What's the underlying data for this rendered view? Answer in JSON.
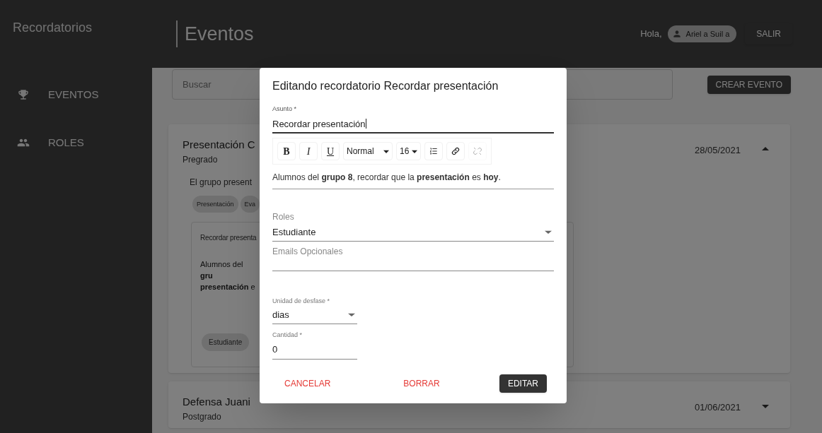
{
  "app_title": "Recordatorios",
  "page_title": "Eventos",
  "greeting": "Hola,",
  "user_chip": "Ariel a Suil a",
  "logout_button": "SALIR",
  "sidebar": {
    "items": [
      {
        "label": "EVENTOS",
        "kind": "trophy"
      },
      {
        "label": "ROLES",
        "kind": "group"
      }
    ]
  },
  "search": {
    "placeholder": "Buscar"
  },
  "create_button": "CREAR EVENTO",
  "events": [
    {
      "title": "Presentación C",
      "subtitle": "Pregrado",
      "date": "28/05/2021",
      "expanded": true,
      "description": "El grupo present",
      "tags": [
        "Presentación",
        "Eva"
      ],
      "reminder": {
        "subject": "Recordar presenta",
        "body": "Alumnos del **gru** **presentación** e",
        "roles": [
          "Estudiante"
        ]
      }
    },
    {
      "title": "Defensa Juani",
      "subtitle": "Postgrado",
      "date": "01/06/2021",
      "expanded": false
    }
  ],
  "dialog": {
    "title": "Editando recordatorio Recordar presentación",
    "subject": {
      "label": "Asunto *",
      "value": "Recordar presentación"
    },
    "toolbar": [
      {
        "kind": "bold",
        "text": "B",
        "disabled": false
      },
      {
        "kind": "italic",
        "text": "I",
        "disabled": false
      },
      {
        "kind": "underline",
        "text": "U",
        "disabled": false
      },
      {
        "kind": "dropdown",
        "text": "Normal",
        "disabled": false
      },
      {
        "kind": "dropdown",
        "text": "16",
        "disabled": false
      },
      {
        "kind": "list",
        "disabled": false
      },
      {
        "kind": "link",
        "disabled": false
      },
      {
        "kind": "unlink",
        "disabled": true
      }
    ],
    "editor_text": "Alumnos del **grupo 8**, recordar que la **presentación** es **hoy**.",
    "fields": [
      {
        "kind": "select",
        "label": "Roles",
        "value": "Estudiante"
      },
      {
        "kind": "textarea",
        "label": "Emails Opcionales"
      },
      {
        "kind": "select",
        "label": "Unidad de desfase *",
        "value": "dias"
      },
      {
        "kind": "text",
        "label": "Cantidad *",
        "value": "0"
      }
    ],
    "buttons": [
      {
        "label": "CANCELAR",
        "kind": "text"
      },
      {
        "label": "BORRAR",
        "kind": "text"
      },
      {
        "label": "EDITAR",
        "kind": "contained"
      }
    ]
  }
}
